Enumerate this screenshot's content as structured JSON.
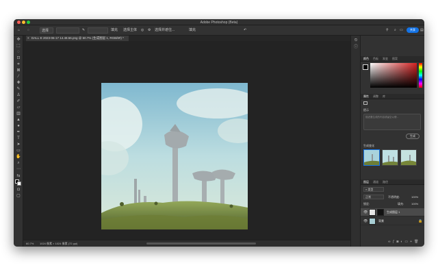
{
  "app": {
    "title": "Adobe Photoshop (Beta)"
  },
  "options_bar": {
    "mode_label": "选择",
    "sample_label": "填充",
    "select_subject": "选择主体",
    "refine_label": "选择并遮住...",
    "fill_label": "填充",
    "share_label": "共享"
  },
  "document": {
    "tab_label": "DALL·E 2023-06-17 14.48.56.png @ 60.7% (生成图层 1, RGB/8#) *"
  },
  "status": {
    "zoom": "60.7%",
    "size": "1024 像素 × 1024 像素 (72 ppi)"
  },
  "color_panel": {
    "tabs": [
      "颜色",
      "色板",
      "渐变",
      "图案"
    ],
    "accent": "#d42121"
  },
  "properties_panel": {
    "tabs": [
      "属性",
      "调整",
      "库"
    ],
    "section": "提示",
    "prompt_placeholder": "描述要生成的内容或留空以便...",
    "generate_label": "生成",
    "variations_label": "生成变化"
  },
  "layers_panel": {
    "tabs": [
      "图层",
      "通道",
      "路径"
    ],
    "kind_filter": "类型",
    "blend_mode": "正常",
    "opacity_label": "不透明度:",
    "opacity_value": "100%",
    "lock_label": "锁定:",
    "fill_label": "填充:",
    "fill_value": "100%",
    "layers": [
      {
        "name": "生成图层 1",
        "selected": true
      },
      {
        "name": "背景",
        "selected": false
      }
    ]
  }
}
